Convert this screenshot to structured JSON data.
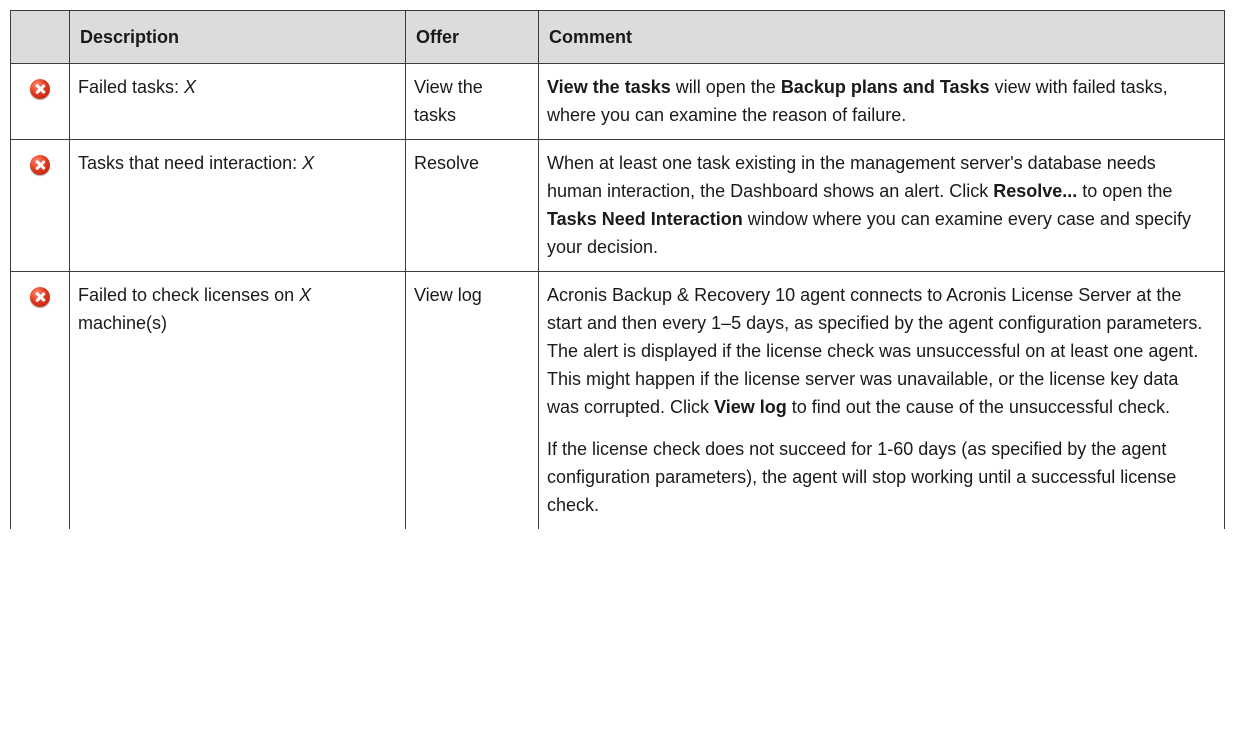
{
  "headers": {
    "description": "Description",
    "offer": "Offer",
    "comment": "Comment"
  },
  "rows": [
    {
      "icon": "error-icon",
      "description_text": "Failed tasks: ",
      "description_var": "X",
      "offer": "View the tasks",
      "comment": {
        "b1": "View the tasks",
        "t1": " will open the ",
        "b2": "Backup plans and Tasks",
        "t2": " view with failed tasks, where you can examine the reason of failure."
      }
    },
    {
      "icon": "error-icon",
      "description_text": "Tasks that need interaction: ",
      "description_var": "X",
      "offer": "Resolve",
      "comment": {
        "t1": "When at least one task existing in the management server's database needs human interaction, the Dashboard shows an alert. Click ",
        "b1": "Resolve...",
        "t2": " to open the ",
        "b2": "Tasks Need Interaction",
        "t3": " window where you can examine every case and specify your decision."
      }
    },
    {
      "icon": "error-icon",
      "description_text": "Failed to check licenses on ",
      "description_var": "X",
      "description_tail": " machine(s)",
      "offer": "View log",
      "comment": {
        "t1": "Acronis Backup & Recovery 10 agent connects to Acronis License Server at the start and then every 1–5 days, as specified by the agent configuration parameters. The alert is displayed if the license check was unsuccessful on at least one agent. This might happen if the license server was unavailable, or the license key data was corrupted. Click ",
        "b1": "View log",
        "t2": " to find out the cause of the unsuccessful check.",
        "p2": "If the license check does not succeed for 1-60 days (as specified by the agent configuration parameters), the agent will stop working until a successful license check."
      }
    }
  ],
  "colors": {
    "header_bg": "#dcdcdc",
    "border": "#3c3c3c",
    "error_icon": "#e2391e"
  }
}
